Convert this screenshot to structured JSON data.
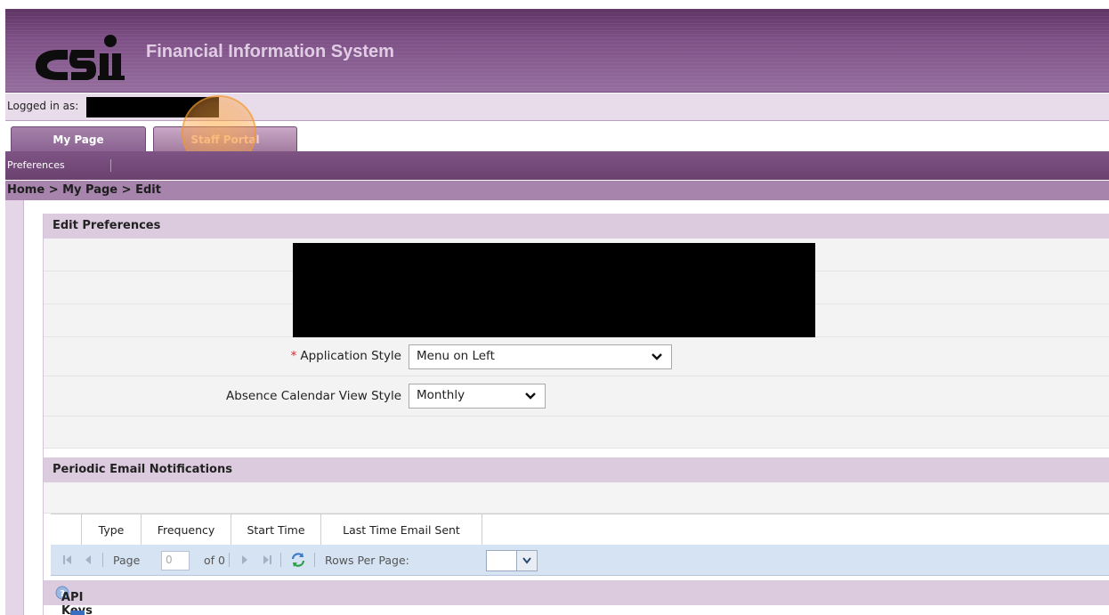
{
  "app": {
    "title": "Financial Information System",
    "logo_alt": "logo"
  },
  "login": {
    "label": "Logged in as:"
  },
  "tabs": [
    {
      "label": "My Page"
    },
    {
      "label": "Staff Portal"
    }
  ],
  "subnav": {
    "items": [
      {
        "label": "Preferences"
      }
    ]
  },
  "breadcrumb": "Home > My Page > Edit",
  "edit_preferences": {
    "heading": "Edit Preferences",
    "application_style": {
      "required_mark": "*",
      "label": "Application Style",
      "value": "Menu on Left"
    },
    "absence_calendar": {
      "label": "Absence Calendar View Style",
      "value": "Monthly"
    }
  },
  "notifications": {
    "heading": "Periodic Email Notifications",
    "columns": [
      "Type",
      "Frequency",
      "Start Time",
      "Last Time Email Sent"
    ],
    "pager": {
      "page_label": "Page",
      "page_value": "0",
      "of_label": "of 0",
      "rows_per_page_label": "Rows Per Page:"
    }
  },
  "api_keys": {
    "heading": "API Keys"
  },
  "colors": {
    "brand_purple": "#7d4f86",
    "tab_purple": "#8b6292",
    "section_header": "#dccbdf",
    "pager_blue": "#d6e3f3"
  }
}
